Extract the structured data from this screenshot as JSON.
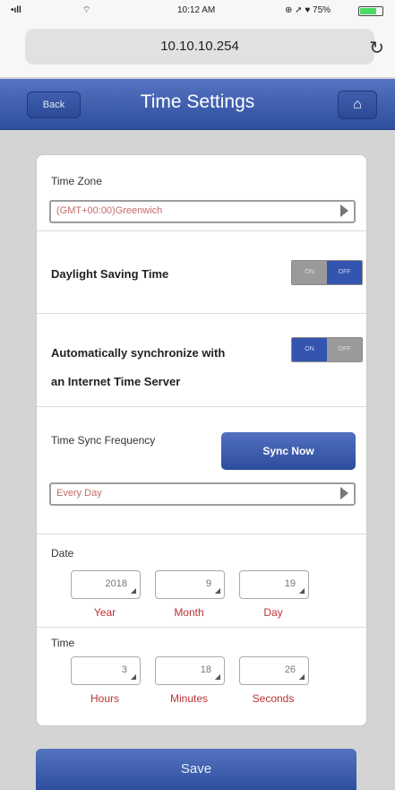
{
  "status": {
    "signal": "•ıll",
    "wifi": "⌔",
    "time": "10:12 AM",
    "misc": "⊕ ➚ ♥ 75%"
  },
  "browser": {
    "url": "10.10.10.254",
    "reload": "↻"
  },
  "header": {
    "back": "Back",
    "title": "Time Settings",
    "home": "⌂"
  },
  "timezone": {
    "label": "Time Zone",
    "value": "(GMT+00:00)Greenwich"
  },
  "dst": {
    "label": "Daylight Saving Time",
    "state": "off",
    "left": "ON",
    "right": "OFF"
  },
  "autosync": {
    "line1": "Automatically synchronize with",
    "line2": "an Internet Time Server",
    "state": "on",
    "left": "ON",
    "right": "OFF"
  },
  "frequency": {
    "label": "Time Sync Frequency",
    "button": "Sync Now",
    "value": "Every Day"
  },
  "date": {
    "label": "Date",
    "fields": [
      {
        "value": "2018",
        "unit": "Year"
      },
      {
        "value": "9",
        "unit": "Month"
      },
      {
        "value": "19",
        "unit": "Day"
      }
    ]
  },
  "time": {
    "label": "Time",
    "fields": [
      {
        "value": "3",
        "unit": "Hours"
      },
      {
        "value": "18",
        "unit": "Minutes"
      },
      {
        "value": "26",
        "unit": "Seconds"
      }
    ]
  },
  "save": "Save",
  "colors": {
    "header": "#2e4f9e",
    "accent_text": "#b33333"
  }
}
